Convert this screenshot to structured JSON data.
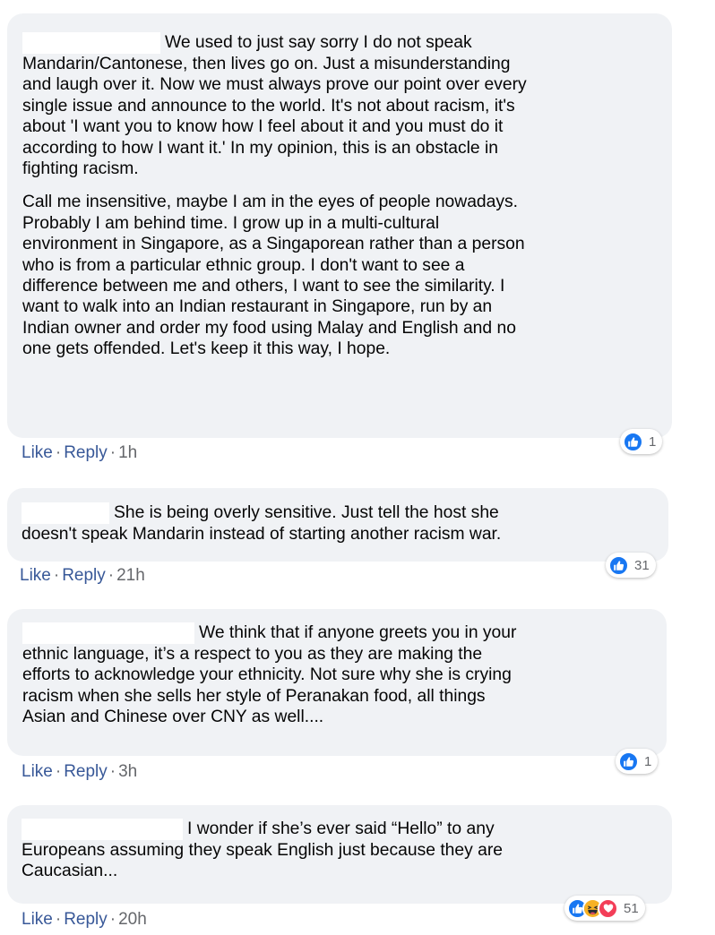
{
  "colors": {
    "bubble_bg": "#f0f2f5",
    "link": "#385898",
    "meta": "#65676b",
    "like_blue": "#1877f2",
    "haha_yellow": "#f7b125",
    "love_red": "#f33e58"
  },
  "comments": [
    {
      "paragraphs": [
        "We used to just say sorry I do not speak\nMandarin/Cantonese, then lives go on. Just a misunderstanding\nand laugh over it. Now we must always prove our point over every\nsingle issue and announce to the world. It's not about racism, it's\nabout 'I want you to know how I feel about it and you must do it\naccording to how I want it.' In my opinion, this is an obstacle in\nfighting racism.",
        "Call me insensitive, maybe I am in the eyes of people nowadays.\nProbably I am behind time. I grow up in a multi-cultural\nenvironment in Singapore, as a Singaporean rather than a person\nwho is from a particular ethnic group. I don't want to see a\ndifference between me and others, I want to see the similarity. I\nwant to walk into an Indian restaurant in Singapore, run by an\nIndian owner and order my food using Malay and English and no\none gets offended. Let's keep it this way, I hope."
      ],
      "like": "Like",
      "reply": "Reply",
      "time": "1h",
      "reactions": [
        "like-icon"
      ],
      "reaction_count": "1"
    },
    {
      "paragraphs": [
        "She is being overly sensitive. Just tell the host she\ndoesn't speak Mandarin instead of starting another racism war."
      ],
      "like": "Like",
      "reply": "Reply",
      "time": "21h",
      "reactions": [
        "like-icon"
      ],
      "reaction_count": "31"
    },
    {
      "paragraphs": [
        "We think that if anyone greets you in your\nethnic language, it’s a respect to you as they are making the\nefforts to acknowledge your ethnicity. Not sure why she is crying\nracism when she sells her style of Peranakan food, all things\nAsian and Chinese over CNY as well...."
      ],
      "like": "Like",
      "reply": "Reply",
      "time": "3h",
      "reactions": [
        "like-icon"
      ],
      "reaction_count": "1"
    },
    {
      "paragraphs": [
        "I wonder if she’s ever said “Hello” to any\nEuropeans assuming they speak English just because they are\nCaucasian..."
      ],
      "like": "Like",
      "reply": "Reply",
      "time": "20h",
      "reactions": [
        "like-icon",
        "haha-icon",
        "love-icon"
      ],
      "reaction_count": "51"
    }
  ]
}
